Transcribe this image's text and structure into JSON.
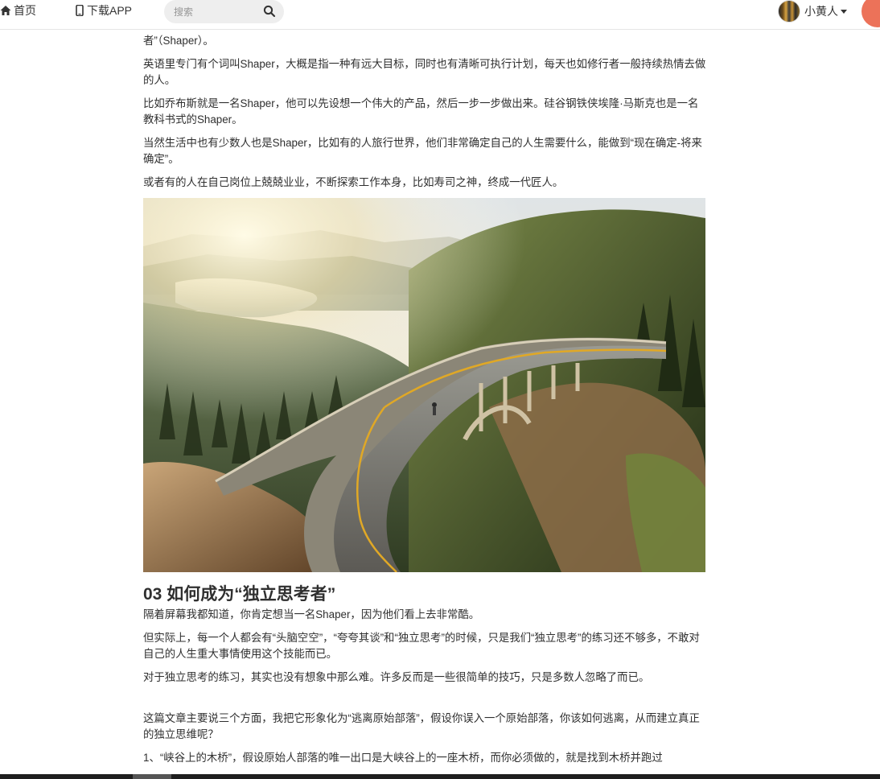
{
  "nav": {
    "home_label": "首页",
    "download_label": "下载APP",
    "search_placeholder": "搜索",
    "user_name": "小黄人"
  },
  "article": {
    "paragraphs_top": [
      "者”（Shaper）。",
      "英语里专门有个词叫Shaper，大概是指一种有远大目标，同时也有清晰可执行计划，每天也如修行者一般持续热情去做的人。",
      "比如乔布斯就是一名Shaper，他可以先设想一个伟大的产品，然后一步一步做出来。硅谷钢铁侠埃隆·马斯克也是一名教科书式的Shaper。",
      "当然生活中也有少数人也是Shaper，比如有的人旅行世界，他们非常确定自己的人生需要什么，能做到“现在确定-将来确定”。",
      "或者有的人在自己岗位上兢兢业业，不断探索工作本身，比如寿司之神，终成一代匠人。"
    ],
    "heading": "03 如何成为“独立思考者”",
    "paragraphs_bottom": [
      "隔着屏幕我都知道，你肯定想当一名Shaper，因为他们看上去非常酷。",
      "但实际上，每一个人都会有“头脑空空”，“夸夸其谈”和“独立思考”的时候，只是我们“独立思考”的练习还不够多，不敢对自己的人生重大事情使用这个技能而已。",
      "对于独立思考的练习，其实也没有想象中那么难。许多反而是一些很简单的技巧，只是多数人忽略了而已。"
    ],
    "paragraphs_end": [
      "这篇文章主要说三个方面，我把它形象化为“逃离原始部落”，假设你误入一个原始部落，你该如何逃离，从而建立真正的独立思维呢？",
      "1、“峡谷上的木桥”，假设原始人部落的唯一出口是大峡谷上的一座木桥，而你必须做的，就是找到木桥并跑过"
    ]
  },
  "colors": {
    "accent": "#ec7259",
    "text": "#2f2f2f"
  }
}
